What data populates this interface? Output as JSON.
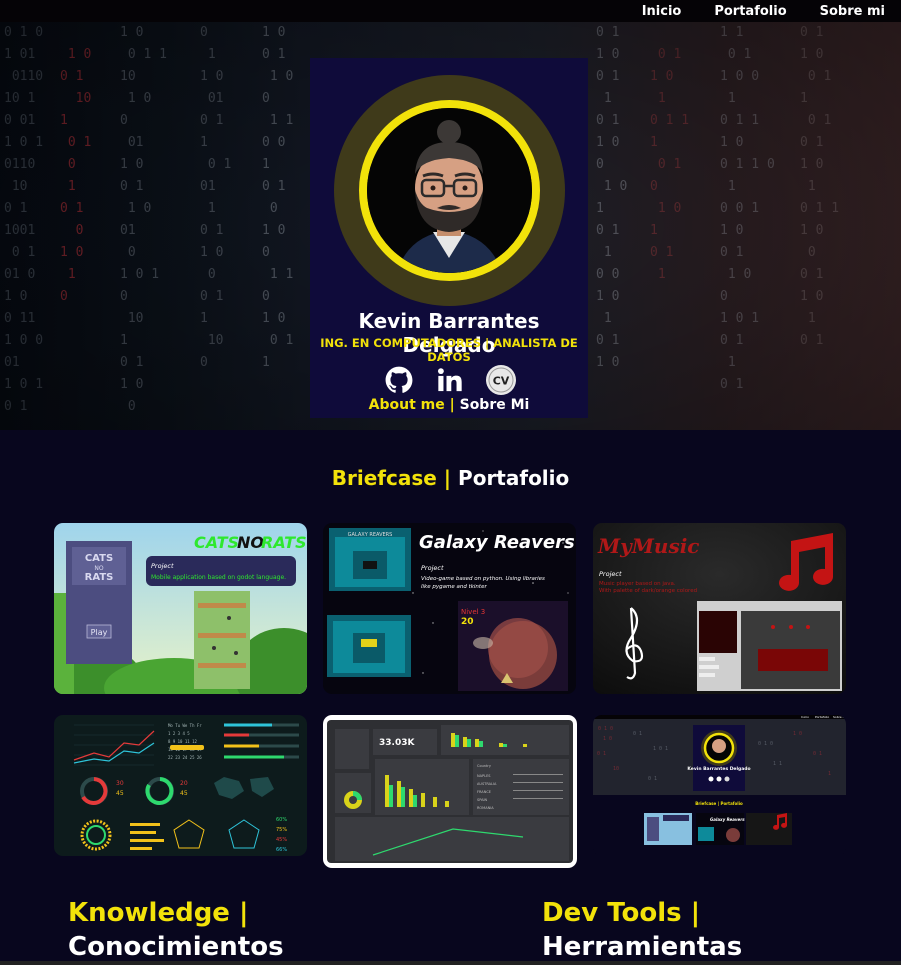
{
  "nav": {
    "items": [
      "Inicio",
      "Portafolio",
      "Sobre mi"
    ]
  },
  "profile": {
    "name": "Kevin Barrantes Delgado",
    "subtitle": "ING. EN COMPUTADORES | ANALISTA DE DATOS",
    "about_en": "About me",
    "about_sep": "|",
    "about_es": "Sobre Mi",
    "social": [
      "github-icon",
      "linkedin-icon",
      "cv-icon"
    ],
    "cv_label": "CV"
  },
  "portfolio": {
    "title_en": "Briefcase",
    "title_sep": "|",
    "title_es": "Portafolio",
    "projects": [
      {
        "title_a": "CATS",
        "title_b": "NO",
        "title_c": "RATS",
        "tag": "Project",
        "desc": "Mobile application based on godot language.",
        "logo_top": "CATS",
        "logo_mid": "NO",
        "logo_bottom": "RATS",
        "play": "Play"
      },
      {
        "title": "Galaxy Reavers",
        "tag": "Project",
        "desc_line1": "Video-game based on python. Using libraries",
        "desc_line2": "like pygame and tkinter",
        "hud_score": "20",
        "hud_label": "Nivel 3"
      },
      {
        "title": "MyMusic",
        "tag": "Project",
        "desc_line1": "Music player based on java.",
        "desc_line2": "With palette of dark/orange colored"
      },
      {
        "title": "dashboard-1"
      },
      {
        "kpi": "33.03K"
      },
      {
        "mini_name": "Kevin Barrantes Delgado",
        "mini_section": "Briefcase | Portafolio",
        "mini_project": "Galaxy Reavers"
      }
    ]
  },
  "knowledge": {
    "line1": "Knowledge |",
    "line2": "Conocimientos"
  },
  "devtools": {
    "line1": "Dev Tools |",
    "line2": "Herramientas"
  },
  "colors": {
    "accent": "#f2e20a",
    "background": "#08061e",
    "card": "#0f0b3a"
  }
}
